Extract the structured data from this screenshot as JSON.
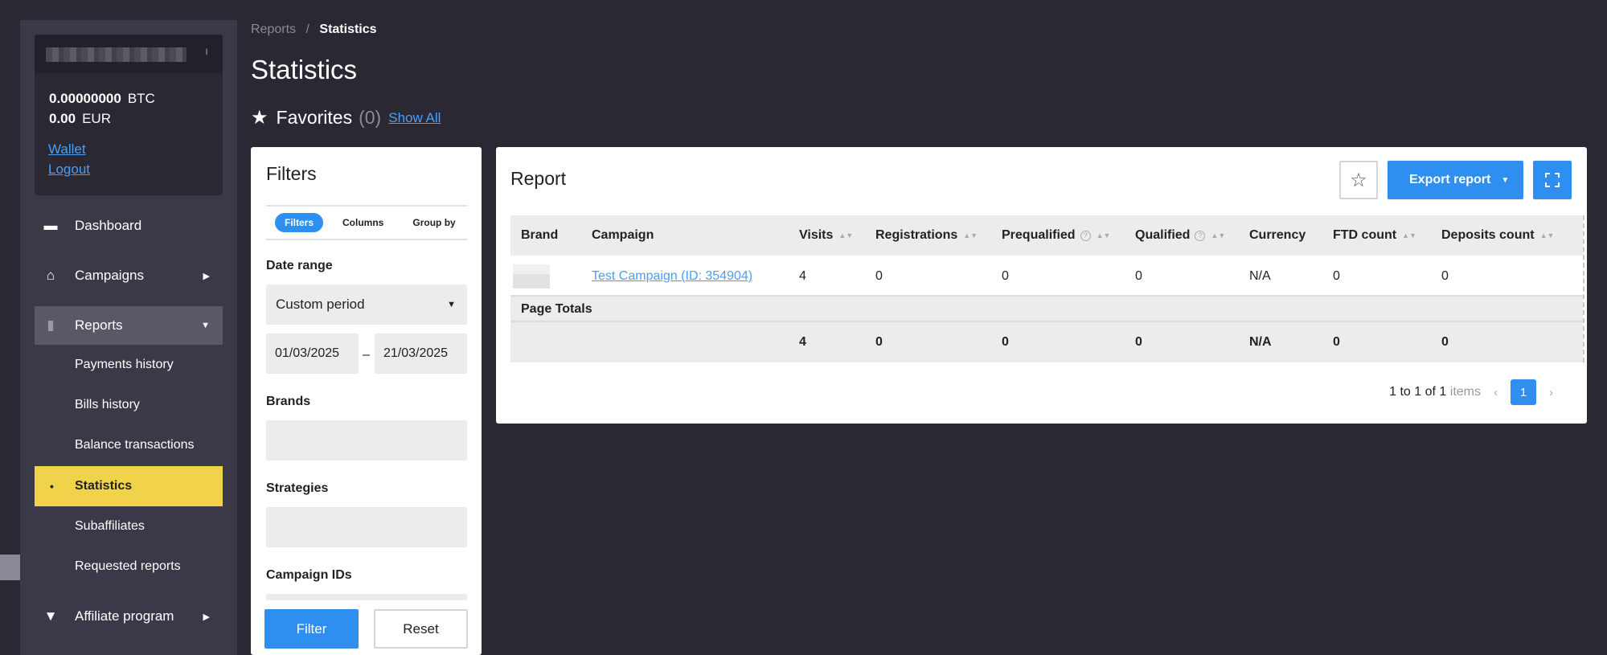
{
  "account": {
    "btc_amount": "0.00000000",
    "btc_currency": "BTC",
    "eur_amount": "0.00",
    "eur_currency": "EUR",
    "wallet_link": "Wallet",
    "logout_link": "Logout"
  },
  "sidebar": {
    "dashboard": "Dashboard",
    "campaigns": "Campaigns",
    "reports": "Reports",
    "sub_items": [
      "Payments history",
      "Bills history",
      "Balance transactions",
      "Statistics",
      "Subaffiliates",
      "Requested reports"
    ],
    "affiliate_program": "Affiliate program"
  },
  "breadcrumb": {
    "parent": "Reports",
    "sep": "/",
    "current": "Statistics"
  },
  "page_title": "Statistics",
  "favorites": {
    "label": "Favorites",
    "count": "(0)",
    "show_all": "Show All"
  },
  "filters": {
    "title": "Filters",
    "tabs": [
      "Filters",
      "Columns",
      "Group by"
    ],
    "date_range_label": "Date range",
    "date_range_value": "Custom period",
    "date_from": "01/03/2025",
    "date_dash": "–",
    "date_to": "21/03/2025",
    "brands_label": "Brands",
    "strategies_label": "Strategies",
    "campaign_ids_label": "Campaign IDs",
    "filter_button": "Filter",
    "reset_button": "Reset"
  },
  "report": {
    "title": "Report",
    "export_button": "Export report",
    "columns": [
      "Brand",
      "Campaign",
      "Visits",
      "Registrations",
      "Prequalified",
      "Qualified",
      "Currency",
      "FTD count",
      "Deposits count"
    ],
    "row": {
      "campaign": "Test Campaign (ID: 354904)",
      "visits": "4",
      "registrations": "0",
      "prequalified": "0",
      "qualified": "0",
      "currency": "N/A",
      "ftd_count": "0",
      "deposits_count": "0"
    },
    "totals_label": "Page Totals",
    "totals": {
      "visits": "4",
      "registrations": "0",
      "prequalified": "0",
      "qualified": "0",
      "currency": "N/A",
      "ftd_count": "0",
      "deposits_count": "0"
    },
    "pagination": {
      "range": "1 to 1 of 1",
      "items_word": "items",
      "current_page": "1"
    }
  }
}
